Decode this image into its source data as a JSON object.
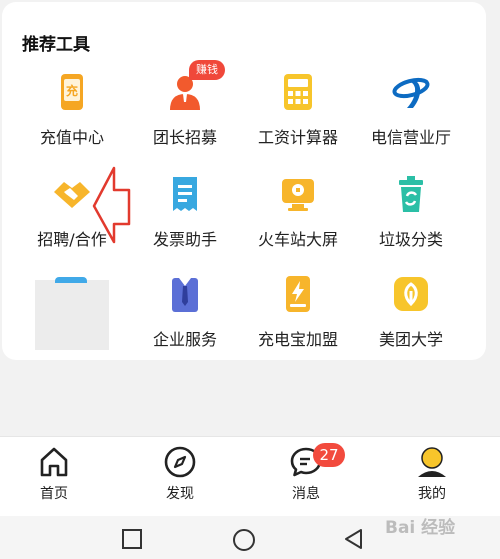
{
  "section": {
    "title": "推荐工具"
  },
  "tools": [
    {
      "label": "充值中心",
      "icon": "recharge-icon",
      "color": "#f5a623"
    },
    {
      "label": "团长招募",
      "icon": "leader-icon",
      "color": "#f25a2d",
      "badge": "赚钱"
    },
    {
      "label": "工资计算器",
      "icon": "calculator-icon",
      "color": "#f7c52b"
    },
    {
      "label": "电信营业厅",
      "icon": "telecom-icon",
      "color": "#0d6bc2"
    },
    {
      "label": "招聘/合作",
      "icon": "handshake-icon",
      "color": "#f7b52b"
    },
    {
      "label": "发票助手",
      "icon": "invoice-icon",
      "color": "#38a8e0"
    },
    {
      "label": "火车站大屏",
      "icon": "train-screen-icon",
      "color": "#f7b52b"
    },
    {
      "label": "垃圾分类",
      "icon": "trash-icon",
      "color": "#2bbfa6"
    },
    {
      "label": "企业服务",
      "icon": "enterprise-icon",
      "color": "#5b6fd6"
    },
    {
      "label": "充电宝加盟",
      "icon": "power-bank-icon",
      "color": "#f7b52b"
    },
    {
      "label": "美团大学",
      "icon": "university-icon",
      "color": "#f7c52b"
    }
  ],
  "tabbar": {
    "items": [
      {
        "label": "首页",
        "icon": "home-icon"
      },
      {
        "label": "发现",
        "icon": "compass-icon"
      },
      {
        "label": "消息",
        "icon": "message-icon",
        "badge": "27"
      },
      {
        "label": "我的",
        "icon": "profile-icon"
      }
    ]
  },
  "watermark": "Bai 经验"
}
